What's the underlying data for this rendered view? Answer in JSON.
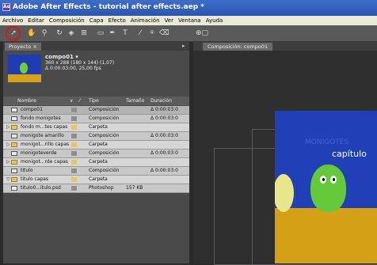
{
  "window": {
    "title": "Adobe After Effects - tutorial after effects.aep *"
  },
  "menu": [
    "Archivo",
    "Editar",
    "Composición",
    "Capa",
    "Efecto",
    "Animación",
    "Ver",
    "Ventana",
    "Ayuda"
  ],
  "project_panel": {
    "tab_label": "Proyecto ×",
    "comp_name": "compo01 ▾",
    "comp_info_1": "360 x 288  (180 x 144) (1,07)",
    "comp_info_2": "Δ 0:00:03:00, 25,00 fps",
    "columns": {
      "name": "Nombre",
      "type": "Tipo",
      "size": "Tamaño",
      "duration": "Duración"
    },
    "items": [
      {
        "name": "compo01",
        "type": "Composición",
        "size": "",
        "duration": "Δ 0:00:03:0",
        "kind": "comp",
        "color": "#8e8e8e",
        "tri": "",
        "selected": true
      },
      {
        "name": "fondo monigotes",
        "type": "Composición",
        "size": "",
        "duration": "Δ 0:00:03:0",
        "kind": "comp",
        "color": "#8e8e8e",
        "tri": ""
      },
      {
        "name": "fondo m...tes capas",
        "type": "Carpeta",
        "size": "",
        "duration": "",
        "kind": "folder",
        "color": "#e6c46a",
        "tri": "▷"
      },
      {
        "name": "monigote amarillo",
        "type": "Composición",
        "size": "",
        "duration": "Δ 0:00:03:0",
        "kind": "comp",
        "color": "#8e8e8e",
        "tri": ""
      },
      {
        "name": "monigot...rillo capas",
        "type": "Carpeta",
        "size": "",
        "duration": "",
        "kind": "folder",
        "color": "#e6c46a",
        "tri": "▷"
      },
      {
        "name": "monigoteverde",
        "type": "Composición",
        "size": "",
        "duration": "Δ 0:00:03:0",
        "kind": "comp",
        "color": "#8e8e8e",
        "tri": ""
      },
      {
        "name": "monigot...rde capas",
        "type": "Carpeta",
        "size": "",
        "duration": "",
        "kind": "folder",
        "color": "#e6c46a",
        "tri": "▷"
      },
      {
        "name": "titulo",
        "type": "Composición",
        "size": "",
        "duration": "Δ 0:00:03:0",
        "kind": "comp",
        "color": "#8e8e8e",
        "tri": ""
      },
      {
        "name": "titulo capas",
        "type": "Carpeta",
        "size": "",
        "duration": "",
        "kind": "folder",
        "color": "#e6c46a",
        "tri": "▽"
      },
      {
        "name": "titulo0...itulo.psd",
        "type": "Photoshop",
        "size": "157 KB",
        "duration": "",
        "kind": "ps",
        "color": "#8e8e8e",
        "tri": ""
      }
    ]
  },
  "composition_panel": {
    "tab_label": "Composición: compo01",
    "title_text": "capítulo",
    "ghost_text": "MONIGOTES"
  },
  "colors": {
    "selection_ring": "#d41a1a",
    "sky": "#2140b8",
    "sand": "#d4a015",
    "character": "#64c93b"
  }
}
